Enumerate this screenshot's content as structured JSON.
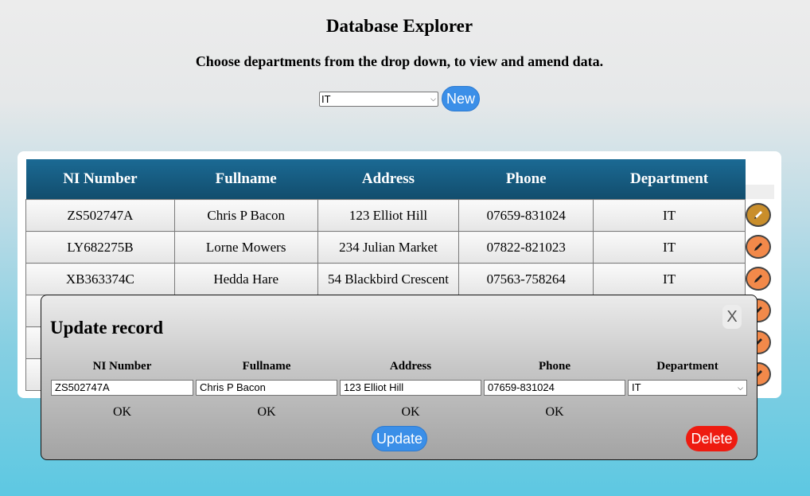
{
  "page": {
    "title": "Database Explorer",
    "subtitle": "Choose departments from the drop down, to view and amend data."
  },
  "controls": {
    "department_selected": "IT",
    "new_label": "New"
  },
  "table": {
    "headers": [
      "NI Number",
      "Fullname",
      "Address",
      "Phone",
      "Department"
    ],
    "rows": [
      [
        "ZS502747A",
        "Chris P Bacon",
        "123 Elliot Hill",
        "07659-831024",
        "IT"
      ],
      [
        "LY682275B",
        "Lorne Mowers",
        "234 Julian Market",
        "07822-821023",
        "IT"
      ],
      [
        "XB363374C",
        "Hedda Hare",
        "54 Blackbird Crescent",
        "07563-758264",
        "IT"
      ]
    ]
  },
  "modal": {
    "title": "Update record",
    "close_label": "X",
    "fields": [
      {
        "label": "NI Number",
        "value": "ZS502747A",
        "status": "OK"
      },
      {
        "label": "Fullname",
        "value": "Chris P Bacon",
        "status": "OK"
      },
      {
        "label": "Address",
        "value": "123 Elliot Hill",
        "status": "OK"
      },
      {
        "label": "Phone",
        "value": "07659-831024",
        "status": "OK"
      },
      {
        "label": "Department",
        "value": "IT"
      }
    ],
    "update_label": "Update",
    "delete_label": "Delete"
  },
  "colors": {
    "header_bg": "#124d6d",
    "primary_button": "#3b8fe8",
    "delete_button": "#ee1b10",
    "edit_button": "#f2894a"
  }
}
